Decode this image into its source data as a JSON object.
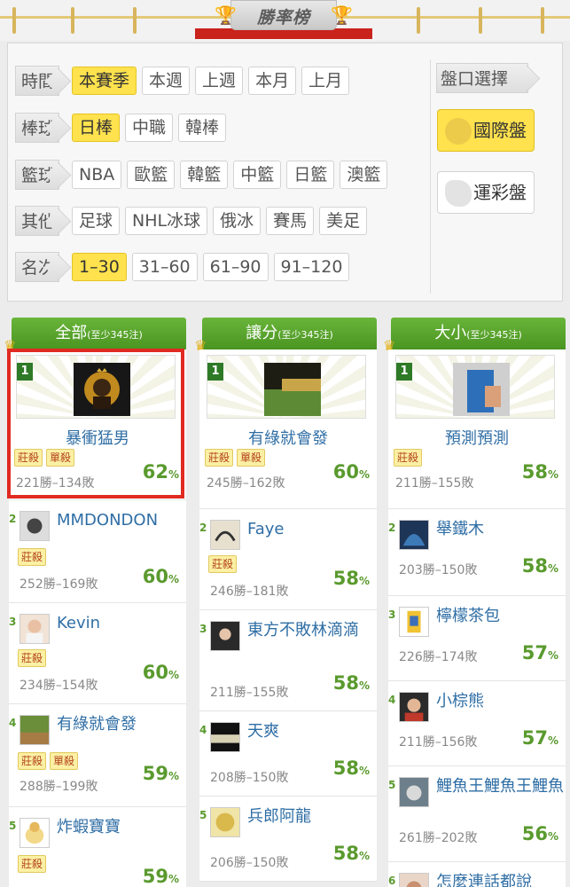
{
  "banner": {
    "title": "勝率榜"
  },
  "filters": {
    "rows": [
      {
        "label": "時間",
        "options": [
          "本賽季",
          "本週",
          "上週",
          "本月",
          "上月"
        ],
        "selected": 0
      },
      {
        "label": "棒球",
        "options": [
          "日棒",
          "中職",
          "韓棒"
        ],
        "selected": 0
      },
      {
        "label": "籃球",
        "options": [
          "NBA",
          "歐籃",
          "韓籃",
          "中籃",
          "日籃",
          "澳籃"
        ],
        "selected": -1
      },
      {
        "label": "其他",
        "options": [
          "足球",
          "NHL冰球",
          "俄冰",
          "賽馬",
          "美足"
        ],
        "selected": -1
      },
      {
        "label": "名次",
        "options": [
          "1–30",
          "31–60",
          "61–90",
          "91–120"
        ],
        "selected": 0
      }
    ],
    "market": {
      "label": "盤口選擇",
      "international": "國際盤",
      "lottery": "運彩盤"
    }
  },
  "columns": [
    {
      "title": "全部",
      "subtitle": "(至少345注)",
      "top": {
        "rank": "1",
        "name": "暴衝猛男",
        "badges": [
          "莊殺",
          "單殺"
        ],
        "record": "221勝–134敗",
        "pct": "62",
        "unit": "%"
      },
      "items": [
        {
          "rank": "2",
          "name": "MMDONDON",
          "badges": [
            "莊殺"
          ],
          "record": "252勝–169敗",
          "pct": "60",
          "unit": "%"
        },
        {
          "rank": "3",
          "name": "Kevin",
          "badges": [
            "莊殺"
          ],
          "record": "234勝–154敗",
          "pct": "60",
          "unit": "%"
        },
        {
          "rank": "4",
          "name": "有綠就會發",
          "badges": [
            "莊殺",
            "單殺"
          ],
          "record": "288勝–199敗",
          "pct": "59",
          "unit": "%"
        },
        {
          "rank": "5",
          "name": "炸蝦寶寶",
          "badges": [
            "莊殺"
          ],
          "record": "",
          "pct": "59",
          "unit": "%"
        }
      ]
    },
    {
      "title": "讓分",
      "subtitle": "(至少345注)",
      "top": {
        "rank": "1",
        "name": "有綠就會發",
        "badges": [
          "莊殺",
          "單殺"
        ],
        "record": "245勝–162敗",
        "pct": "60",
        "unit": "%"
      },
      "items": [
        {
          "rank": "2",
          "name": "Faye",
          "badges": [
            "莊殺"
          ],
          "record": "246勝–181敗",
          "pct": "58",
          "unit": "%"
        },
        {
          "rank": "3",
          "name": "東方不敗林滴滴",
          "badges": [],
          "record": "211勝–155敗",
          "pct": "58",
          "unit": "%"
        },
        {
          "rank": "4",
          "name": "天爽",
          "badges": [],
          "record": "208勝–150敗",
          "pct": "58",
          "unit": "%"
        },
        {
          "rank": "5",
          "name": "兵郎阿龍",
          "badges": [],
          "record": "206勝–150敗",
          "pct": "58",
          "unit": "%"
        }
      ]
    },
    {
      "title": "大小",
      "subtitle": "(至少345注)",
      "top": {
        "rank": "1",
        "name": "預測預測",
        "badges": [
          "莊殺"
        ],
        "record": "211勝–155敗",
        "pct": "58",
        "unit": "%"
      },
      "items": [
        {
          "rank": "2",
          "name": "舉鐵木",
          "badges": [],
          "record": "203勝–150敗",
          "pct": "58",
          "unit": "%"
        },
        {
          "rank": "3",
          "name": "檸檬茶包",
          "badges": [],
          "record": "226勝–174敗",
          "pct": "57",
          "unit": "%"
        },
        {
          "rank": "4",
          "name": "小棕熊",
          "badges": [],
          "record": "211勝–156敗",
          "pct": "57",
          "unit": "%"
        },
        {
          "rank": "5",
          "name": "鯉魚王鯉魚王鯉魚",
          "badges": [],
          "record": "261勝–202敗",
          "pct": "56",
          "unit": "%"
        },
        {
          "rank": "6",
          "name": "怎麼連話都說",
          "badges": [],
          "record": "",
          "pct": "",
          "unit": ""
        }
      ]
    }
  ]
}
